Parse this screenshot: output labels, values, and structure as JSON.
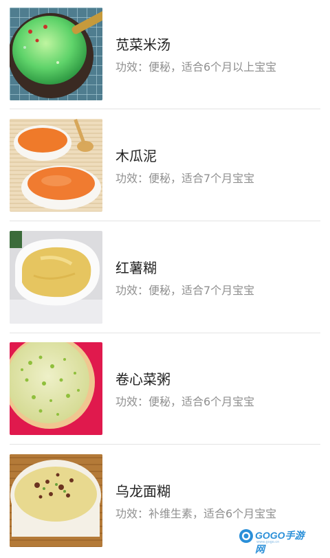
{
  "recipes": [
    {
      "name": "苋菜米汤",
      "effect": "功效：便秘，适合6个月以上宝宝",
      "image": "green-vegetable-rice-soup-photo"
    },
    {
      "name": "木瓜泥",
      "effect": "功效：便秘，适合7个月宝宝",
      "image": "papaya-puree-photo"
    },
    {
      "name": "红薯糊",
      "effect": "功效：便秘，适合7个月宝宝",
      "image": "sweet-potato-paste-photo"
    },
    {
      "name": "卷心菜粥",
      "effect": "功效：便秘，适合6个月宝宝",
      "image": "cabbage-porridge-photo"
    },
    {
      "name": "乌龙面糊",
      "effect": "功效：补维生素，适合6个月宝宝",
      "image": "udon-noodle-paste-photo"
    }
  ],
  "watermark": {
    "brand": "GOGO手游网",
    "url": "www.gogo.cn"
  }
}
